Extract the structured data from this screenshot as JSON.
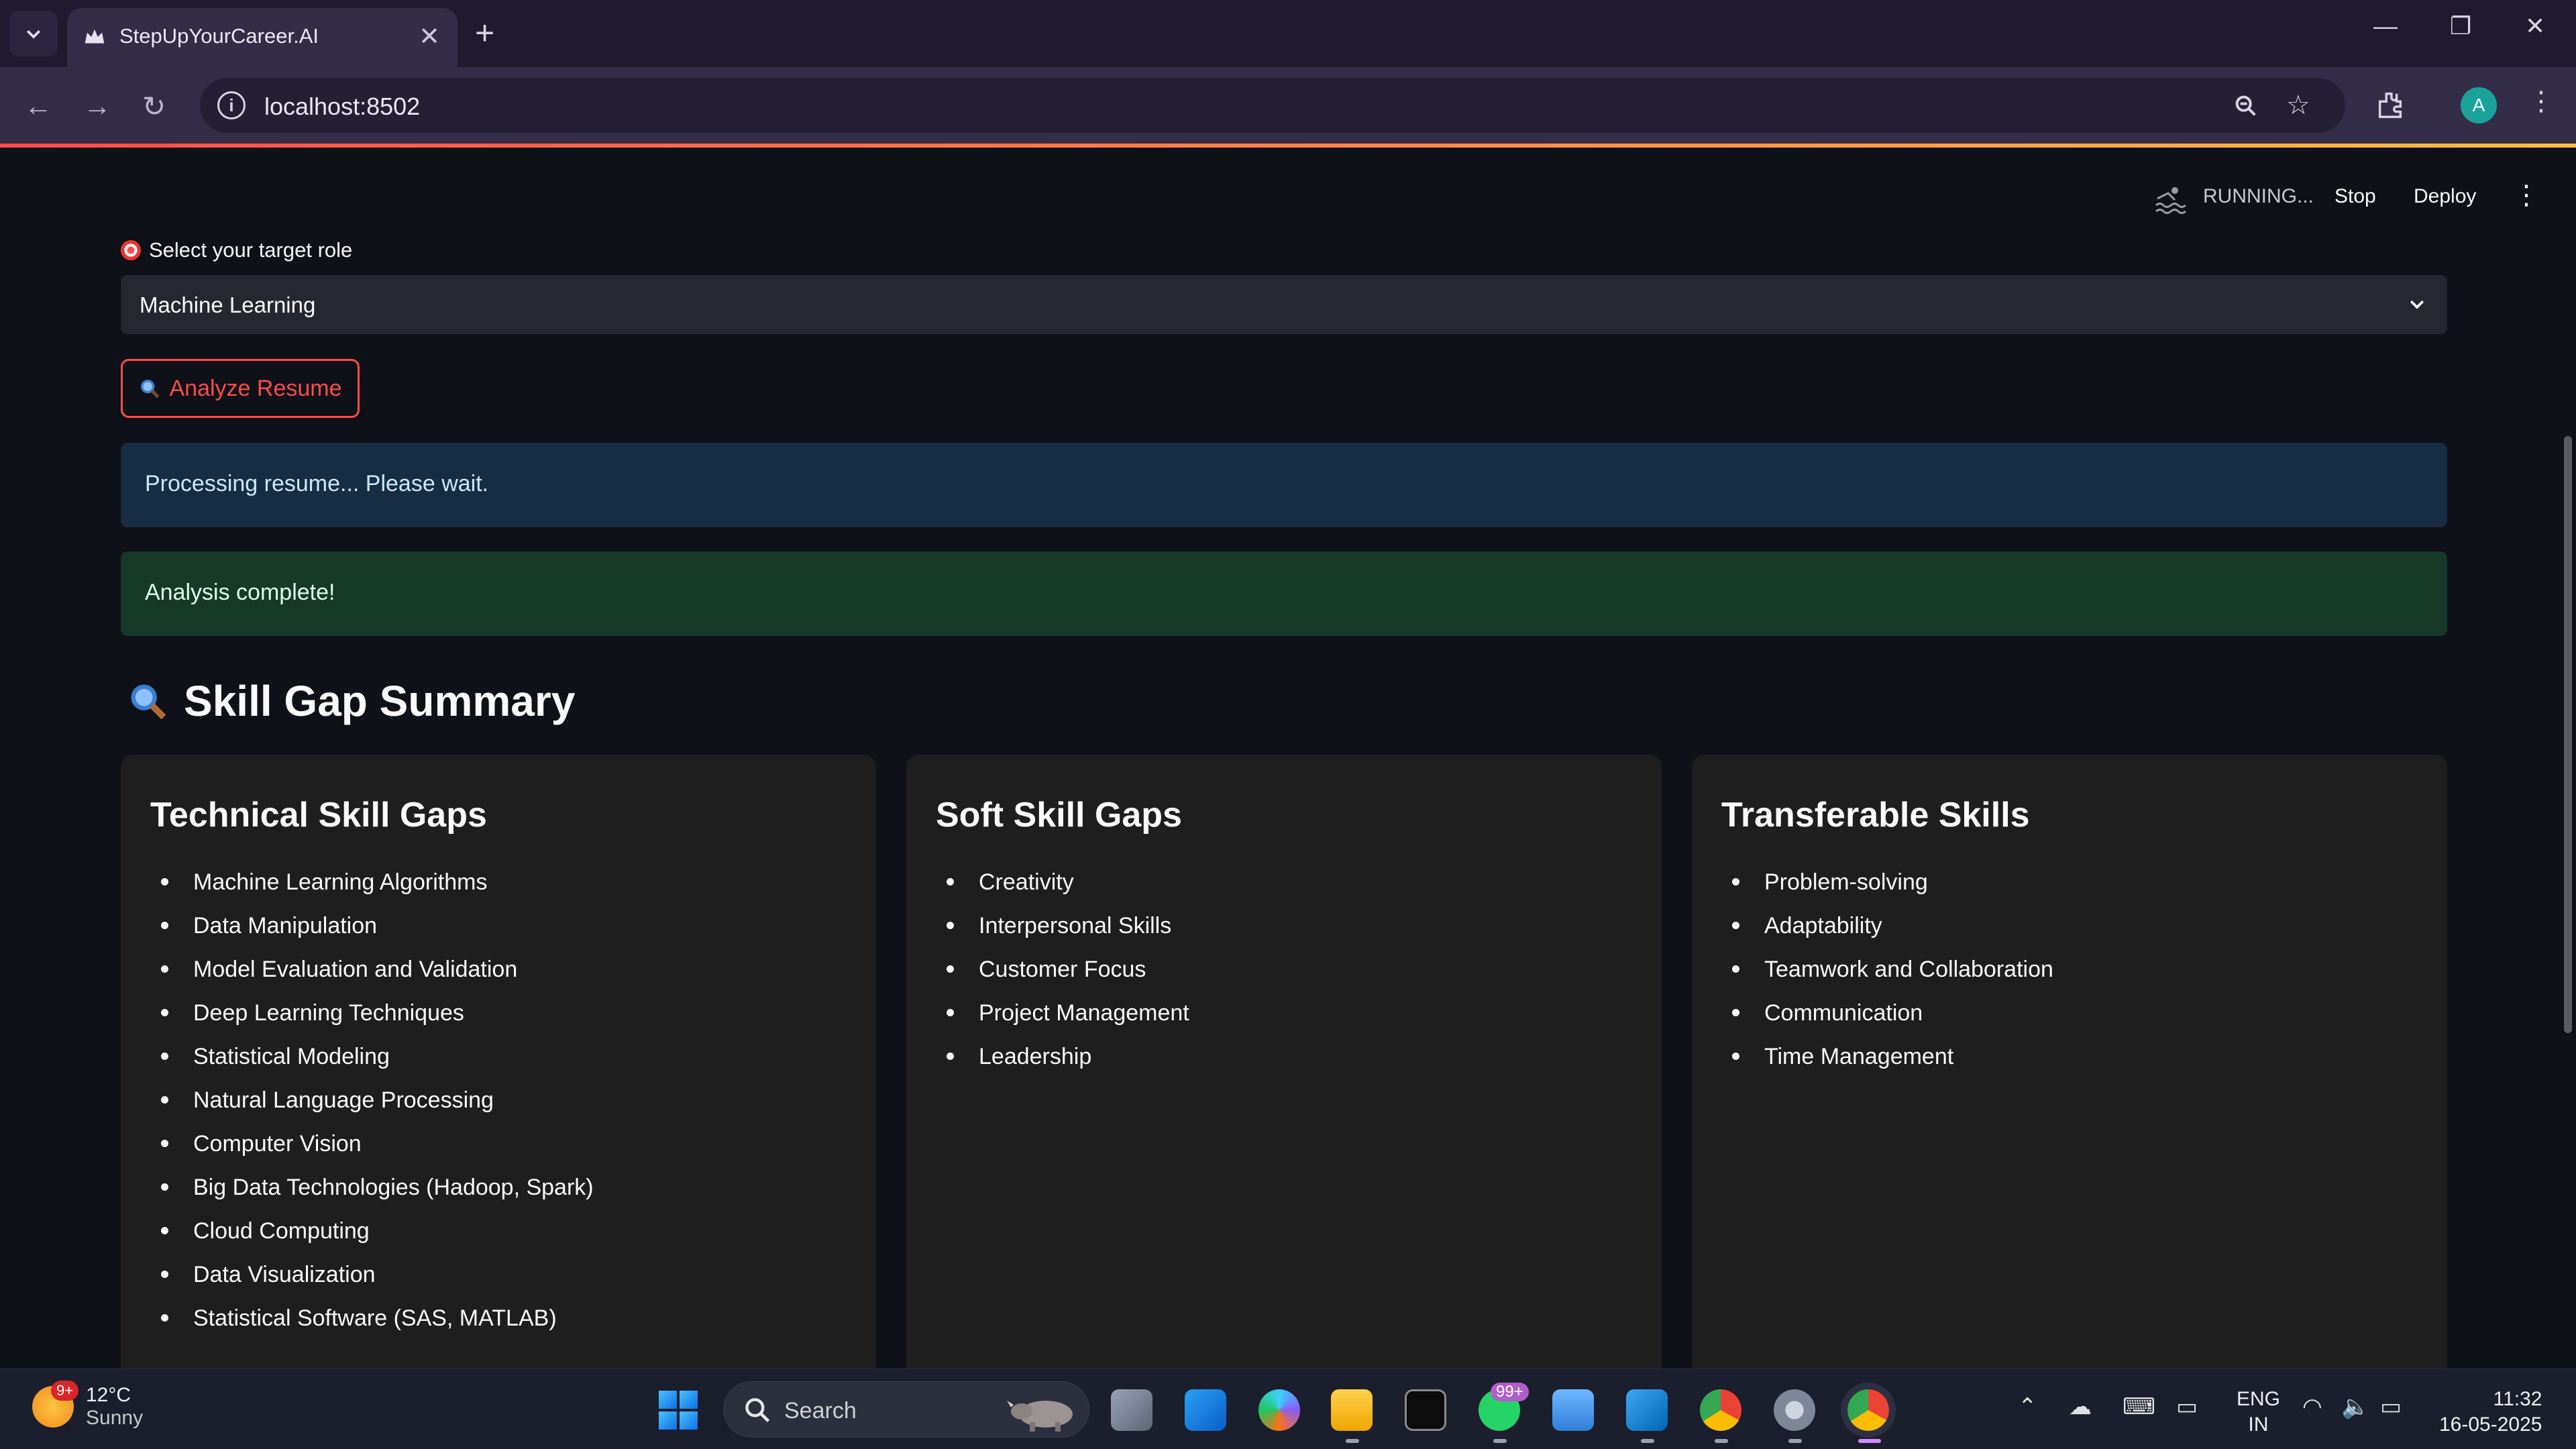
{
  "browser": {
    "tab_title": "StepUpYourCareer.AI",
    "url": "localhost:8502"
  },
  "streamlit_header": {
    "status": "RUNNING...",
    "stop_label": "Stop",
    "deploy_label": "Deploy"
  },
  "form": {
    "role_label": "Select your target role",
    "role_value": "Machine Learning",
    "analyze_label": "Analyze Resume"
  },
  "alerts": {
    "info": "Processing resume... Please wait.",
    "success": "Analysis complete!"
  },
  "summary": {
    "title": "Skill Gap Summary",
    "cards": [
      {
        "title": "Technical Skill Gaps",
        "items": [
          "Machine Learning Algorithms",
          "Data Manipulation",
          "Model Evaluation and Validation",
          "Deep Learning Techniques",
          "Statistical Modeling",
          "Natural Language Processing",
          "Computer Vision",
          "Big Data Technologies (Hadoop, Spark)",
          "Cloud Computing",
          "Data Visualization",
          "Statistical Software (SAS, MATLAB)"
        ]
      },
      {
        "title": "Soft Skill Gaps",
        "items": [
          "Creativity",
          "Interpersonal Skills",
          "Customer Focus",
          "Project Management",
          "Leadership"
        ]
      },
      {
        "title": "Transferable Skills",
        "items": [
          "Problem-solving",
          "Adaptability",
          "Teamwork and Collaboration",
          "Communication",
          "Time Management"
        ]
      }
    ]
  },
  "taskbar": {
    "weather_badge": "9+",
    "weather_temp": "12°C",
    "weather_desc": "Sunny",
    "search_placeholder": "Search",
    "whatsapp_badge": "99+",
    "lang_top": "ENG",
    "lang_bottom": "IN",
    "time": "11:32",
    "date": "16-05-2025"
  },
  "profile_initial": "A",
  "colors": {
    "accent": "#ff4b4b",
    "background": "#0e1117",
    "info_bg": "#172d43",
    "success_bg": "#173928",
    "card_bg": "#1e1e1f"
  }
}
